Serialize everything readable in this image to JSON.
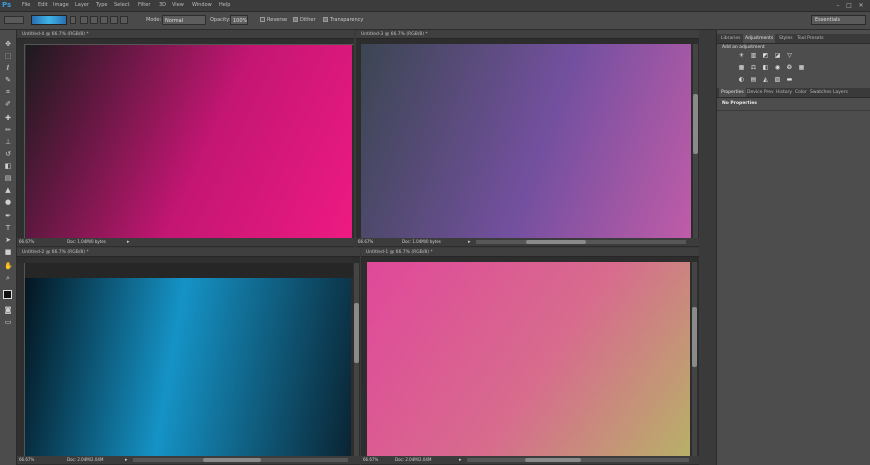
{
  "app": {
    "logo": "Ps"
  },
  "menu": [
    "File",
    "Edit",
    "Image",
    "Layer",
    "Type",
    "Select",
    "Filter",
    "3D",
    "View",
    "Window",
    "Help"
  ],
  "window_controls": [
    "–",
    "□",
    "✕"
  ],
  "options_bar": {
    "mode_label": "Mode:",
    "mode_value": "Normal",
    "opacity_label": "Opacity:",
    "opacity_value": "100%",
    "reverse_label": "Reverse",
    "dither_label": "Dither",
    "transparency_label": "Transparency",
    "workspace": "Essentials"
  },
  "documents": [
    {
      "tab": "Untitled-4 @ 66.7% (RGB/8) *",
      "zoom": "66.67%",
      "doc_size": "Doc: 1.04M/0 bytes",
      "colors": [
        "#1c1a1d",
        "#c41673",
        "#ee1a82"
      ]
    },
    {
      "tab": "Untitled-3 @ 66.7% (RGB/8) *",
      "zoom": "66.67%",
      "doc_size": "Doc: 1.04M/0 bytes",
      "colors": [
        "#3b4652",
        "#7450a0",
        "#c05ca8"
      ]
    },
    {
      "tab": "Untitled-2 @ 66.7% (RGB/8) *",
      "zoom": "66.67%",
      "doc_size": "Doc: 2.04M/2.04M",
      "colors": [
        "#04151f",
        "#1593c6",
        "#0a2433"
      ]
    },
    {
      "tab": "Untitled-1 @ 66.7% (RGB/8) *",
      "zoom": "66.67%",
      "doc_size": "Doc: 2.04M/2.04M",
      "colors": [
        "#e0489a",
        "#d76c8d",
        "#b8b068"
      ]
    }
  ],
  "panels": {
    "top_tabs": [
      "Libraries",
      "Adjustments",
      "Styles",
      "Tool Presets"
    ],
    "active_top_tab": "Adjustments",
    "add_adjustment": "Add an adjustment",
    "bottom_tabs": [
      "Properties",
      "Device Prev",
      "History",
      "Color",
      "Swatches",
      "Layers"
    ],
    "active_bottom_tab": "Properties",
    "no_properties": "No Properties"
  },
  "tool_icons": [
    "move-icon",
    "marquee-icon",
    "lasso-icon",
    "quick-select-icon",
    "crop-icon",
    "eyedropper-icon",
    "healing-icon",
    "brush-icon",
    "stamp-icon",
    "history-brush-icon",
    "eraser-icon",
    "gradient-icon",
    "blur-icon",
    "dodge-icon",
    "pen-icon",
    "type-icon",
    "path-select-icon",
    "shape-icon",
    "hand-icon",
    "zoom-icon"
  ]
}
